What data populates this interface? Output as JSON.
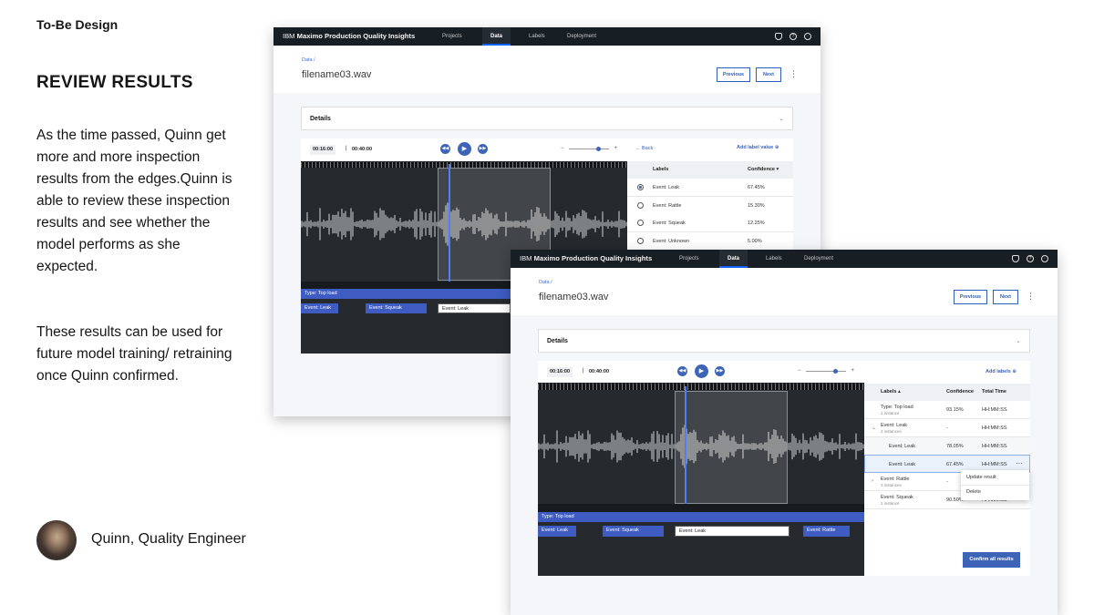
{
  "story": {
    "tag": "To-Be Design",
    "title": "REVIEW RESULTS",
    "paragraph1": "As the time passed, Quinn get more and more inspection results from the edges.Quinn is able to review these inspection results and see whether the model performs as she expected.",
    "paragraph2": "These results can be used for future model training/ retraining once Quinn confirmed.",
    "persona": "Quinn, Quality Engineer"
  },
  "app": {
    "brand_prefix": "IBM",
    "brand_name": "Maximo Production Quality Insights",
    "nav": [
      "Projects",
      "Data",
      "Labels",
      "Deployment"
    ],
    "active_nav": "Data"
  },
  "screen1": {
    "breadcrumb": "Data  /",
    "filename": "filename03.wav",
    "previous": "Previous",
    "next": "Next",
    "details": "Details",
    "current_time": "00:16:00",
    "total_time": "00:40:00",
    "back": "Back",
    "add_label_value": "Add label value",
    "col_labels": "Labels",
    "col_confidence": "Confidence",
    "rows": [
      {
        "label": "Event: Leak",
        "confidence": "67.45%",
        "selected": true
      },
      {
        "label": "Event: Rattle",
        "confidence": "15.30%",
        "selected": false
      },
      {
        "label": "Event: Squeak",
        "confidence": "12.25%",
        "selected": false
      },
      {
        "label": "Event: Unknown",
        "confidence": "5.00%",
        "selected": false
      }
    ],
    "top_label": "Type: Top load",
    "chips": [
      "Event: Leak",
      "Event: Squeak",
      "Event: Leak"
    ]
  },
  "screen2": {
    "breadcrumb": "Data  /",
    "filename": "filename03.wav",
    "previous": "Previous",
    "next": "Next",
    "details": "Details",
    "current_time": "00:16:00",
    "total_time": "00:40:00",
    "add_labels": "Add labels",
    "col_labels": "Labels",
    "col_confidence": "Confidence",
    "col_total_time": "Total Time",
    "rows": [
      {
        "label": "Type: Top load",
        "sub": "1 instance",
        "confidence": "93.15%",
        "time": "HH:MM:SS"
      },
      {
        "label": "Event: Leak",
        "sub": "2 instances",
        "confidence": "-",
        "time": "HH:MM:SS"
      },
      {
        "label": "Event: Leak",
        "sub": "",
        "confidence": "78.05%",
        "time": "HH:MM:SS"
      },
      {
        "label": "Event: Leak",
        "sub": "",
        "confidence": "67.45%",
        "time": "HH:MM:SS"
      },
      {
        "label": "Event: Rattle",
        "sub": "3 instances",
        "confidence": "-",
        "time": ""
      },
      {
        "label": "Event: Squeak",
        "sub": "1 instance",
        "confidence": "90.50%",
        "time": "HH:MM:SS"
      }
    ],
    "menu": [
      "Update result",
      "Delete"
    ],
    "top_label": "Type: Top load",
    "chips": [
      "Event: Leak",
      "Event: Squeak",
      "Event: Leak",
      "Event: Rattle"
    ],
    "confirm": "Confirm all results"
  }
}
